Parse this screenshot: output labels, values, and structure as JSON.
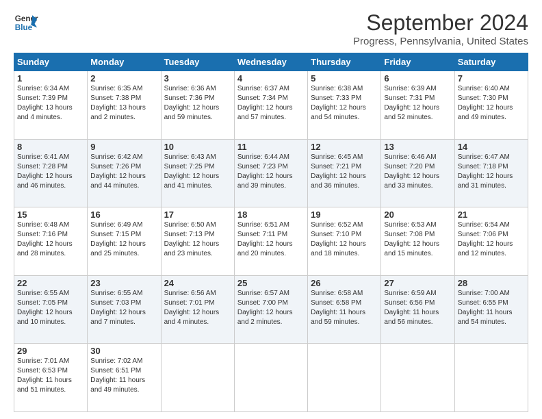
{
  "header": {
    "logo_line1": "General",
    "logo_line2": "Blue",
    "title": "September 2024",
    "subtitle": "Progress, Pennsylvania, United States"
  },
  "columns": [
    "Sunday",
    "Monday",
    "Tuesday",
    "Wednesday",
    "Thursday",
    "Friday",
    "Saturday"
  ],
  "weeks": [
    [
      {
        "day": "1",
        "info": "Sunrise: 6:34 AM\nSunset: 7:39 PM\nDaylight: 13 hours\nand 4 minutes."
      },
      {
        "day": "2",
        "info": "Sunrise: 6:35 AM\nSunset: 7:38 PM\nDaylight: 13 hours\nand 2 minutes."
      },
      {
        "day": "3",
        "info": "Sunrise: 6:36 AM\nSunset: 7:36 PM\nDaylight: 12 hours\nand 59 minutes."
      },
      {
        "day": "4",
        "info": "Sunrise: 6:37 AM\nSunset: 7:34 PM\nDaylight: 12 hours\nand 57 minutes."
      },
      {
        "day": "5",
        "info": "Sunrise: 6:38 AM\nSunset: 7:33 PM\nDaylight: 12 hours\nand 54 minutes."
      },
      {
        "day": "6",
        "info": "Sunrise: 6:39 AM\nSunset: 7:31 PM\nDaylight: 12 hours\nand 52 minutes."
      },
      {
        "day": "7",
        "info": "Sunrise: 6:40 AM\nSunset: 7:30 PM\nDaylight: 12 hours\nand 49 minutes."
      }
    ],
    [
      {
        "day": "8",
        "info": "Sunrise: 6:41 AM\nSunset: 7:28 PM\nDaylight: 12 hours\nand 46 minutes."
      },
      {
        "day": "9",
        "info": "Sunrise: 6:42 AM\nSunset: 7:26 PM\nDaylight: 12 hours\nand 44 minutes."
      },
      {
        "day": "10",
        "info": "Sunrise: 6:43 AM\nSunset: 7:25 PM\nDaylight: 12 hours\nand 41 minutes."
      },
      {
        "day": "11",
        "info": "Sunrise: 6:44 AM\nSunset: 7:23 PM\nDaylight: 12 hours\nand 39 minutes."
      },
      {
        "day": "12",
        "info": "Sunrise: 6:45 AM\nSunset: 7:21 PM\nDaylight: 12 hours\nand 36 minutes."
      },
      {
        "day": "13",
        "info": "Sunrise: 6:46 AM\nSunset: 7:20 PM\nDaylight: 12 hours\nand 33 minutes."
      },
      {
        "day": "14",
        "info": "Sunrise: 6:47 AM\nSunset: 7:18 PM\nDaylight: 12 hours\nand 31 minutes."
      }
    ],
    [
      {
        "day": "15",
        "info": "Sunrise: 6:48 AM\nSunset: 7:16 PM\nDaylight: 12 hours\nand 28 minutes."
      },
      {
        "day": "16",
        "info": "Sunrise: 6:49 AM\nSunset: 7:15 PM\nDaylight: 12 hours\nand 25 minutes."
      },
      {
        "day": "17",
        "info": "Sunrise: 6:50 AM\nSunset: 7:13 PM\nDaylight: 12 hours\nand 23 minutes."
      },
      {
        "day": "18",
        "info": "Sunrise: 6:51 AM\nSunset: 7:11 PM\nDaylight: 12 hours\nand 20 minutes."
      },
      {
        "day": "19",
        "info": "Sunrise: 6:52 AM\nSunset: 7:10 PM\nDaylight: 12 hours\nand 18 minutes."
      },
      {
        "day": "20",
        "info": "Sunrise: 6:53 AM\nSunset: 7:08 PM\nDaylight: 12 hours\nand 15 minutes."
      },
      {
        "day": "21",
        "info": "Sunrise: 6:54 AM\nSunset: 7:06 PM\nDaylight: 12 hours\nand 12 minutes."
      }
    ],
    [
      {
        "day": "22",
        "info": "Sunrise: 6:55 AM\nSunset: 7:05 PM\nDaylight: 12 hours\nand 10 minutes."
      },
      {
        "day": "23",
        "info": "Sunrise: 6:55 AM\nSunset: 7:03 PM\nDaylight: 12 hours\nand 7 minutes."
      },
      {
        "day": "24",
        "info": "Sunrise: 6:56 AM\nSunset: 7:01 PM\nDaylight: 12 hours\nand 4 minutes."
      },
      {
        "day": "25",
        "info": "Sunrise: 6:57 AM\nSunset: 7:00 PM\nDaylight: 12 hours\nand 2 minutes."
      },
      {
        "day": "26",
        "info": "Sunrise: 6:58 AM\nSunset: 6:58 PM\nDaylight: 11 hours\nand 59 minutes."
      },
      {
        "day": "27",
        "info": "Sunrise: 6:59 AM\nSunset: 6:56 PM\nDaylight: 11 hours\nand 56 minutes."
      },
      {
        "day": "28",
        "info": "Sunrise: 7:00 AM\nSunset: 6:55 PM\nDaylight: 11 hours\nand 54 minutes."
      }
    ],
    [
      {
        "day": "29",
        "info": "Sunrise: 7:01 AM\nSunset: 6:53 PM\nDaylight: 11 hours\nand 51 minutes."
      },
      {
        "day": "30",
        "info": "Sunrise: 7:02 AM\nSunset: 6:51 PM\nDaylight: 11 hours\nand 49 minutes."
      },
      null,
      null,
      null,
      null,
      null
    ]
  ]
}
